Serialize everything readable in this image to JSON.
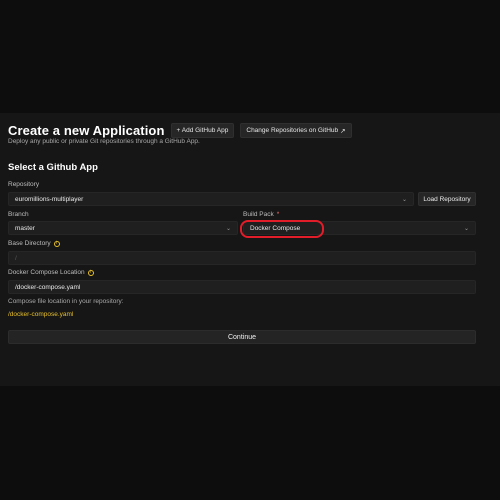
{
  "header": {
    "title": "Create a new Application",
    "add_github_app": "+ Add GitHub App",
    "change_repos": "Change Repositories on GitHub",
    "change_repos_icon": "↗",
    "subtitle": "Deploy any public or private Git repositories through a GitHub App."
  },
  "section": {
    "title": "Select a Github App"
  },
  "form": {
    "repository": {
      "label": "Repository",
      "value": "euromillions-multiplayer"
    },
    "load_repository": "Load Repository",
    "branch": {
      "label": "Branch",
      "value": "master"
    },
    "build_pack": {
      "label": "Build Pack",
      "required_mark": "*",
      "value": "Docker Compose"
    },
    "base_directory": {
      "label": "Base Directory",
      "value": "/"
    },
    "compose_location": {
      "label": "Docker Compose Location",
      "value": "/docker-compose.yaml"
    },
    "helper_text": "Compose file location in your repository:",
    "compose_path": "/docker-compose.yaml",
    "continue": "Continue"
  },
  "colors": {
    "accent": "#e7c02a",
    "highlight": "#e11d2a",
    "background": "#161616"
  }
}
